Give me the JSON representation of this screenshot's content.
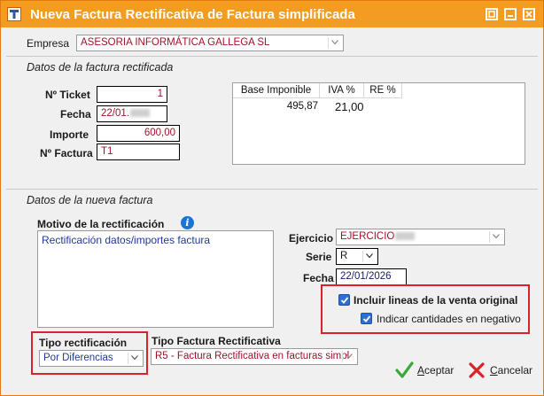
{
  "window": {
    "title": "Nueva Factura Rectificativa de Factura simplificada",
    "accent_color": "#f39c1f",
    "icons": [
      "app-icon",
      "restore-icon",
      "minimize-icon",
      "close-icon"
    ]
  },
  "empresa": {
    "label": "Empresa",
    "value": "ASESORIA INFORMÁTICA GALLEGA SL"
  },
  "rectificada": {
    "section_title": "Datos de la factura rectificada",
    "ticket_label": "Nº Ticket",
    "ticket_value": "1",
    "fecha_label": "Fecha",
    "fecha_value": "22/01.",
    "importe_label": "Importe",
    "importe_value": "600,00",
    "factura_label": "Nº Factura",
    "factura_value": "T1",
    "grid": {
      "columns": [
        "Base Imponible",
        "IVA %",
        "RE %"
      ],
      "rows": [
        [
          "495,87",
          "21,00",
          ""
        ]
      ]
    }
  },
  "nueva": {
    "section_title": "Datos de la nueva factura",
    "motivo_label": "Motivo de la rectificación",
    "motivo_value": "Rectificación datos/importes factura",
    "ejercicio_label": "Ejercicio",
    "ejercicio_value": "EJERCICIO",
    "serie_label": "Serie",
    "serie_value": "R",
    "fecha_label": "Fecha",
    "fecha_value": "22/01/2026",
    "incluir_lineas_label": "Incluir lineas de la venta original",
    "incluir_lineas_checked": true,
    "cantidades_negativo_label": "Indicar cantidades en negativo",
    "cantidades_negativo_checked": true,
    "tipo_rect_label": "Tipo rectificación",
    "tipo_rect_value": "Por Diferencias",
    "tipo_factura_label": "Tipo Factura Rectificativa",
    "tipo_factura_value": "R5 - Factura Rectificativa en facturas simpl"
  },
  "buttons": {
    "aceptar_first": "A",
    "aceptar_rest": "ceptar",
    "cancelar_first": "C",
    "cancelar_rest": "ancelar"
  }
}
